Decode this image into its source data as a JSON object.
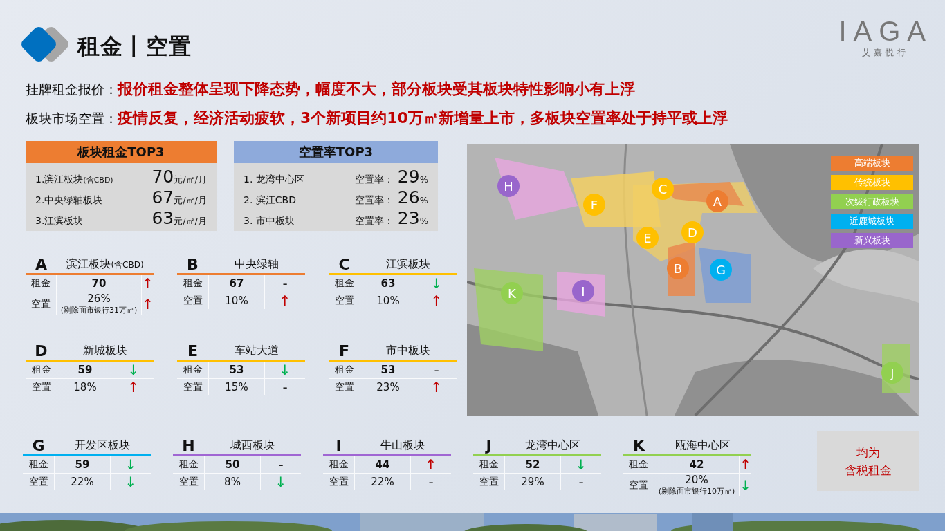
{
  "header": {
    "title": "租金丨空置",
    "logo": {
      "mark": "IAGA",
      "subtitle": "艾嘉悦行"
    }
  },
  "summary": [
    {
      "label": "挂牌租金报价：",
      "text": "报价租金整体呈现下降态势，幅度不大，部分板块受其板块特性影响小有上浮"
    },
    {
      "label": "板块市场空置：",
      "text": "疫情反复，经济活动疲软，3个新项目约10万㎡新增量上市，多板块空置率处于持平或上浮"
    }
  ],
  "rent_top3": {
    "title": "板块租金TOP3",
    "color": "#ed7d31",
    "rows": [
      {
        "name": "1.滨江板块",
        "note": "(含CBD)",
        "value": "70",
        "unit": "元/㎡/月"
      },
      {
        "name": "2.中央绿轴板块",
        "value": "67",
        "unit": "元/㎡/月"
      },
      {
        "name": "3.江滨板块",
        "value": "63",
        "unit": "元/㎡/月"
      }
    ]
  },
  "vacancy_top3": {
    "title": "空置率TOP3",
    "color": "#8eaadb",
    "rows": [
      {
        "name": "1. 龙湾中心区",
        "label": "空置率：",
        "value": "29",
        "unit": "%"
      },
      {
        "name": "2. 滨江CBD",
        "label": "空置率：",
        "value": "26",
        "unit": "%"
      },
      {
        "name": "3. 市中板块",
        "label": "空置率：",
        "value": "23",
        "unit": "%"
      }
    ]
  },
  "districts": [
    {
      "letter": "A",
      "name": "滨江板块",
      "name_note": "(含CBD)",
      "color": "#ed7d31",
      "rent_label": "租金",
      "rent": "70",
      "rent_trend": {
        "kind": "up",
        "symbol": "↑"
      },
      "vacancy_label": "空置",
      "vacancy": "26%",
      "vacancy_note": "(剔除面市银行31万㎡)",
      "vacancy_trend": {
        "kind": "up",
        "symbol": "↑"
      }
    },
    {
      "letter": "B",
      "name": "中央绿轴",
      "color": "#ed7d31",
      "rent_label": "租金",
      "rent": "67",
      "rent_trend": {
        "kind": "flat",
        "symbol": "-"
      },
      "vacancy_label": "空置",
      "vacancy": "10%",
      "vacancy_trend": {
        "kind": "up",
        "symbol": "↑"
      }
    },
    {
      "letter": "C",
      "name": "江滨板块",
      "color": "#ffc000",
      "rent_label": "租金",
      "rent": "63",
      "rent_trend": {
        "kind": "down",
        "symbol": "↓"
      },
      "vacancy_label": "空置",
      "vacancy": "10%",
      "vacancy_trend": {
        "kind": "up",
        "symbol": "↑"
      }
    },
    {
      "letter": "D",
      "name": "新城板块",
      "color": "#ffc000",
      "rent_label": "租金",
      "rent": "59",
      "rent_trend": {
        "kind": "down",
        "symbol": "↓"
      },
      "vacancy_label": "空置",
      "vacancy": "18%",
      "vacancy_trend": {
        "kind": "up",
        "symbol": "↑"
      }
    },
    {
      "letter": "E",
      "name": "车站大道",
      "color": "#ffc000",
      "rent_label": "租金",
      "rent": "53",
      "rent_trend": {
        "kind": "down",
        "symbol": "↓"
      },
      "vacancy_label": "空置",
      "vacancy": "15%",
      "vacancy_trend": {
        "kind": "flat",
        "symbol": "-"
      }
    },
    {
      "letter": "F",
      "name": "市中板块",
      "color": "#ffc000",
      "rent_label": "租金",
      "rent": "53",
      "rent_trend": {
        "kind": "flat",
        "symbol": "-"
      },
      "vacancy_label": "空置",
      "vacancy": "23%",
      "vacancy_trend": {
        "kind": "up",
        "symbol": "↑"
      }
    },
    {
      "letter": "G",
      "name": "开发区板块",
      "color": "#00b0f0",
      "rent_label": "租金",
      "rent": "59",
      "rent_trend": {
        "kind": "down",
        "symbol": "↓"
      },
      "vacancy_label": "空置",
      "vacancy": "22%",
      "vacancy_trend": {
        "kind": "down",
        "symbol": "↓"
      }
    },
    {
      "letter": "H",
      "name": "城西板块",
      "color": "#a066d3",
      "rent_label": "租金",
      "rent": "50",
      "rent_trend": {
        "kind": "flat",
        "symbol": "-"
      },
      "vacancy_label": "空置",
      "vacancy": "8%",
      "vacancy_trend": {
        "kind": "down",
        "symbol": "↓"
      }
    },
    {
      "letter": "I",
      "name": "牛山板块",
      "color": "#a066d3",
      "rent_label": "租金",
      "rent": "44",
      "rent_trend": {
        "kind": "up",
        "symbol": "↑"
      },
      "vacancy_label": "空置",
      "vacancy": "22%",
      "vacancy_trend": {
        "kind": "flat",
        "symbol": "-"
      }
    },
    {
      "letter": "J",
      "name": "龙湾中心区",
      "color": "#92d050",
      "rent_label": "租金",
      "rent": "52",
      "rent_trend": {
        "kind": "down",
        "symbol": "↓"
      },
      "vacancy_label": "空置",
      "vacancy": "29%",
      "vacancy_trend": {
        "kind": "flat",
        "symbol": "-"
      }
    },
    {
      "letter": "K",
      "name": "瓯海中心区",
      "color": "#92d050",
      "rent_label": "租金",
      "rent": "42",
      "rent_trend": {
        "kind": "up",
        "symbol": "↑"
      },
      "vacancy_label": "空置",
      "vacancy": "20%",
      "vacancy_note": "(剔除面市银行10万㎡)",
      "vacancy_trend": {
        "kind": "down",
        "symbol": "↓"
      }
    }
  ],
  "map": {
    "kind": "picture",
    "markers": [
      {
        "letter": "H",
        "color": "#9966cc"
      },
      {
        "letter": "F",
        "color": "#ffc000"
      },
      {
        "letter": "C",
        "color": "#ffc000"
      },
      {
        "letter": "A",
        "color": "#ed7d31"
      },
      {
        "letter": "E",
        "color": "#ffc000"
      },
      {
        "letter": "D",
        "color": "#ffc000"
      },
      {
        "letter": "B",
        "color": "#ed7d31"
      },
      {
        "letter": "G",
        "color": "#00b0f0"
      },
      {
        "letter": "K",
        "color": "#92d050"
      },
      {
        "letter": "I",
        "color": "#9966cc"
      },
      {
        "letter": "J",
        "color": "#92d050"
      }
    ],
    "legend": [
      {
        "label": "高端板块",
        "color": "#ed7d31"
      },
      {
        "label": "传统板块",
        "color": "#ffc000"
      },
      {
        "label": "次级行政板块",
        "color": "#92d050"
      },
      {
        "label": "近鹿城板块",
        "color": "#00b0f0"
      },
      {
        "label": "新兴板块",
        "color": "#9966cc"
      }
    ]
  },
  "note": {
    "lines": [
      "均为",
      "含税租金"
    ]
  }
}
